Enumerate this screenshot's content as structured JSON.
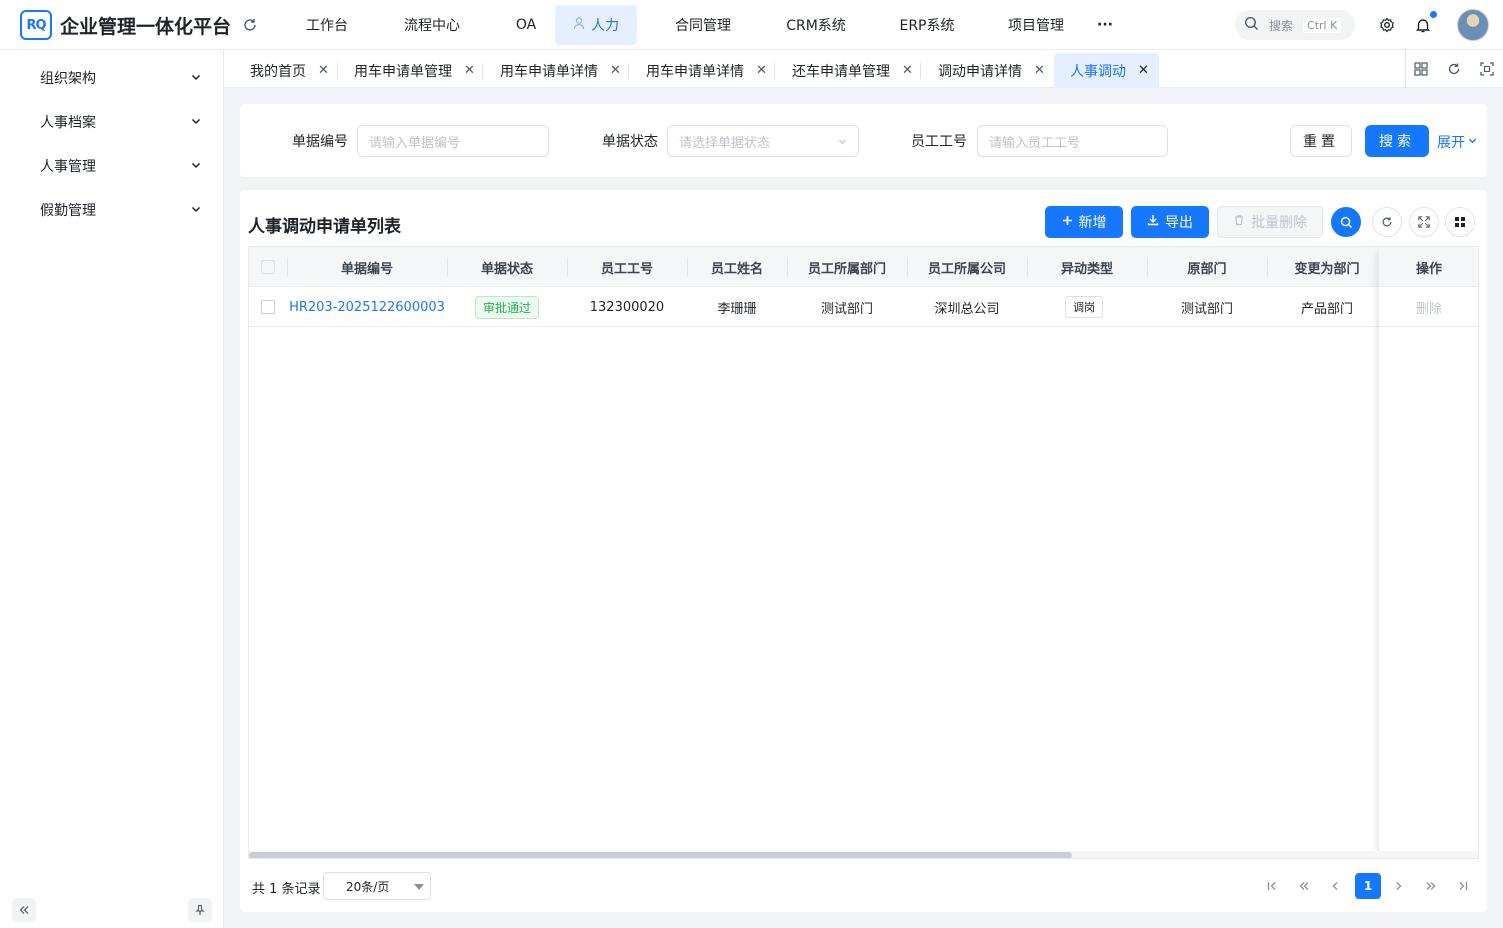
{
  "brand": {
    "logo_text": "RQ",
    "title": "企业管理一体化平台",
    "accent": "#1677ff"
  },
  "nav": {
    "items": [
      {
        "label": "工作台"
      },
      {
        "label": "流程中心"
      },
      {
        "label": "OA"
      },
      {
        "label": "人力",
        "active": true
      },
      {
        "label": "合同管理"
      },
      {
        "label": "CRM系统"
      },
      {
        "label": "ERP系统"
      },
      {
        "label": "项目管理"
      },
      {
        "label": "···"
      }
    ]
  },
  "search": {
    "label": "搜索",
    "shortcut": "Ctrl K"
  },
  "sidebar": {
    "items": [
      {
        "label": "组织架构"
      },
      {
        "label": "人事档案"
      },
      {
        "label": "人事管理"
      },
      {
        "label": "假勤管理"
      }
    ]
  },
  "tabs": [
    {
      "label": "我的首页"
    },
    {
      "label": "用车申请单管理"
    },
    {
      "label": "用车申请单详情"
    },
    {
      "label": "用车申请单详情"
    },
    {
      "label": "还车申请单管理"
    },
    {
      "label": "调动申请详情"
    },
    {
      "label": "人事调动",
      "active": true
    }
  ],
  "filters": {
    "doc_no": {
      "label": "单据编号",
      "placeholder": "请输入单据编号"
    },
    "status": {
      "label": "单据状态",
      "placeholder": "请选择单据状态"
    },
    "emp_no": {
      "label": "员工工号",
      "placeholder": "请输入员工工号"
    },
    "reset_label": "重置",
    "search_label": "搜索",
    "expand_label": "展开"
  },
  "table": {
    "title": "人事调动申请单列表",
    "add_label": "新增",
    "export_label": "导出",
    "batch_delete_label": "批量删除",
    "columns": [
      "单据编号",
      "单据状态",
      "员工工号",
      "员工姓名",
      "员工所属部门",
      "员工所属公司",
      "异动类型",
      "原部门",
      "变更为部门",
      "操作"
    ],
    "rows": [
      {
        "doc_no": "HR203-2025122600003",
        "status": "审批通过",
        "emp_no": "132300020",
        "emp_name": "李珊珊",
        "dept": "测试部门",
        "company": "深圳总公司",
        "change_type": "调岗",
        "orig_dept": "测试部门",
        "new_dept": "产品部门",
        "action": "删除"
      }
    ]
  },
  "pagination": {
    "total_text": "共 1 条记录",
    "page_size": "20条/页",
    "current_page": "1"
  }
}
